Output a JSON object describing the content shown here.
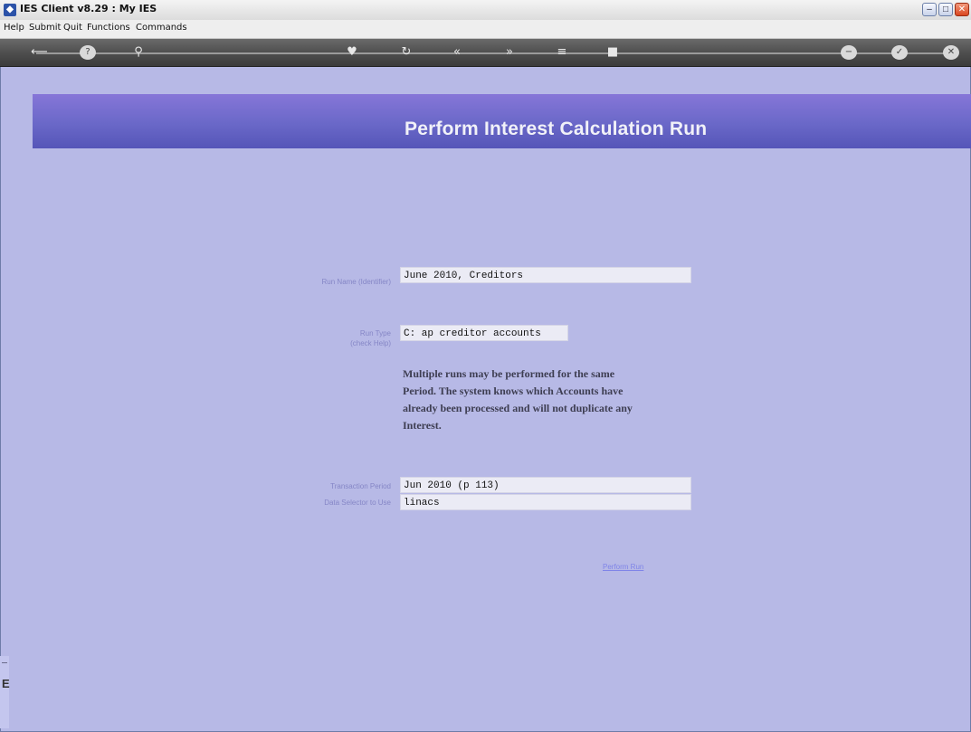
{
  "window": {
    "title": "IES Client v8.29 : My IES"
  },
  "menu": {
    "items": [
      "Help",
      "Submit",
      "Quit",
      "Functions",
      "Commands"
    ]
  },
  "toolbar": {
    "icons": [
      "back-arrow-icon",
      "help-icon",
      "search-icon",
      "heart-icon",
      "refresh-icon",
      "previous-icon",
      "next-icon",
      "list-icon",
      "stop-icon",
      "minus-icon",
      "check-icon",
      "close-icon"
    ]
  },
  "page": {
    "title": "Perform Interest Calculation Run"
  },
  "form": {
    "run_name": {
      "label": "Run Name (Identifier)",
      "value": "June 2010, Creditors"
    },
    "run_type": {
      "label": "Run Type",
      "value": "C: ap creditor accounts",
      "hint": "(check Help)"
    },
    "help_text": "Multiple runs may be performed for the same Period. The system knows which Accounts have already been processed and will not duplicate any Interest.",
    "transaction_period": {
      "label": "Transaction Period",
      "value": "Jun 2010 (p 113)"
    },
    "data_selector": {
      "label": "Data Selector to Use",
      "value": "linacs"
    },
    "perform_link": "Perform Run"
  },
  "sidebar": {
    "letter": "E"
  },
  "colors": {
    "background": "#b7b9e6",
    "header_band": "#6a68c8",
    "title_text": "#f1f1f8",
    "link": "#7f84e8"
  }
}
